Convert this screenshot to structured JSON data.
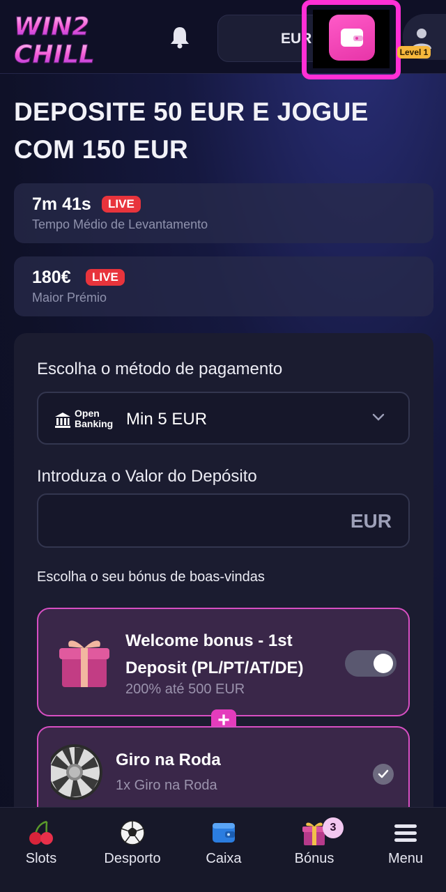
{
  "header": {
    "logo_text": "WIN2 CHILL",
    "currency": "EUR",
    "level": "Level 1"
  },
  "promo": {
    "title": "DEPOSITE 50 EUR E JOGUE COM 150 EUR"
  },
  "stats": [
    {
      "value": "7m 41s",
      "badge": "LIVE",
      "desc": "Tempo Médio de Levantamento"
    },
    {
      "value": "180€",
      "badge": "LIVE",
      "desc": "Maior Prémio"
    }
  ],
  "deposit": {
    "payment_label": "Escolha o método de pagamento",
    "method_logo": "Open Banking",
    "method_logo_line1": "Open",
    "method_logo_line2": "Banking",
    "method_value": "Min 5 EUR",
    "amount_label": "Introduza o Valor do Depósito",
    "amount_currency": "EUR",
    "bonus_label": "Escolha o seu bónus de boas-vindas"
  },
  "bonuses": [
    {
      "title": "Welcome bonus - 1st Deposit (PL/PT/AT/DE)",
      "subtitle": "200% até 500 EUR",
      "enabled": true
    },
    {
      "title": "Giro na Roda",
      "subtitle": "1x Giro na Roda",
      "selected": true
    }
  ],
  "bonus_plus": "+",
  "nav": [
    {
      "label": "Slots",
      "icon": "cherries-icon"
    },
    {
      "label": "Desporto",
      "icon": "soccer-ball-icon"
    },
    {
      "label": "Caixa",
      "icon": "wallet-icon"
    },
    {
      "label": "Bónus",
      "icon": "gift-icon",
      "badge": "3"
    },
    {
      "label": "Menu",
      "icon": "hamburger-icon"
    }
  ],
  "colors": {
    "accent_pink": "#e735a8",
    "live_red": "#e8343c",
    "bonus_border": "#d84fc3",
    "level_gold": "#f6b73c"
  }
}
